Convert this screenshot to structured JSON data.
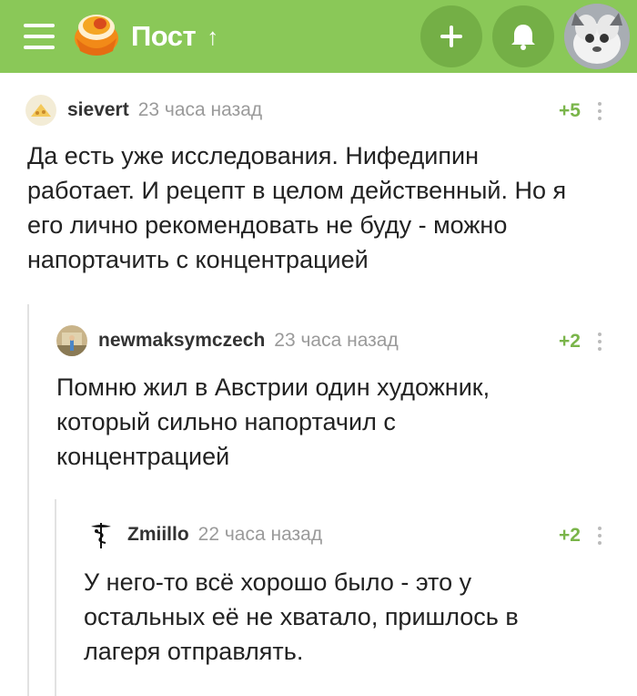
{
  "header": {
    "title": "Пост",
    "arrow": "↑",
    "add_label": "+",
    "icons": [
      "menu-icon",
      "pikabu-logo",
      "plus-icon",
      "bell-icon",
      "avatar"
    ]
  },
  "colors": {
    "header_bg": "#8ac858",
    "score": "#7ab54a"
  },
  "comments": [
    {
      "author": "sievert",
      "time": "23 часа назад",
      "score": "+5",
      "lines": [
        "Да есть уже исследования. Нифедипин",
        "работает. И рецепт в целом действенный. Но я",
        "его лично рекомендовать не буду - можно",
        "напортачить с концентрацией"
      ]
    },
    {
      "author": "newmaksymczech",
      "time": "23 часа назад",
      "score": "+2",
      "lines": [
        "Помню жил в Австрии один художник,",
        "который сильно напортачил с",
        "концентрацией"
      ]
    },
    {
      "author": "Zmiillo",
      "time": "22 часа назад",
      "score": "+2",
      "lines": [
        "У него-то всё хорошо было - это у",
        "остальных её не хватало, пришлось в",
        "лагеря отправлять."
      ]
    }
  ]
}
